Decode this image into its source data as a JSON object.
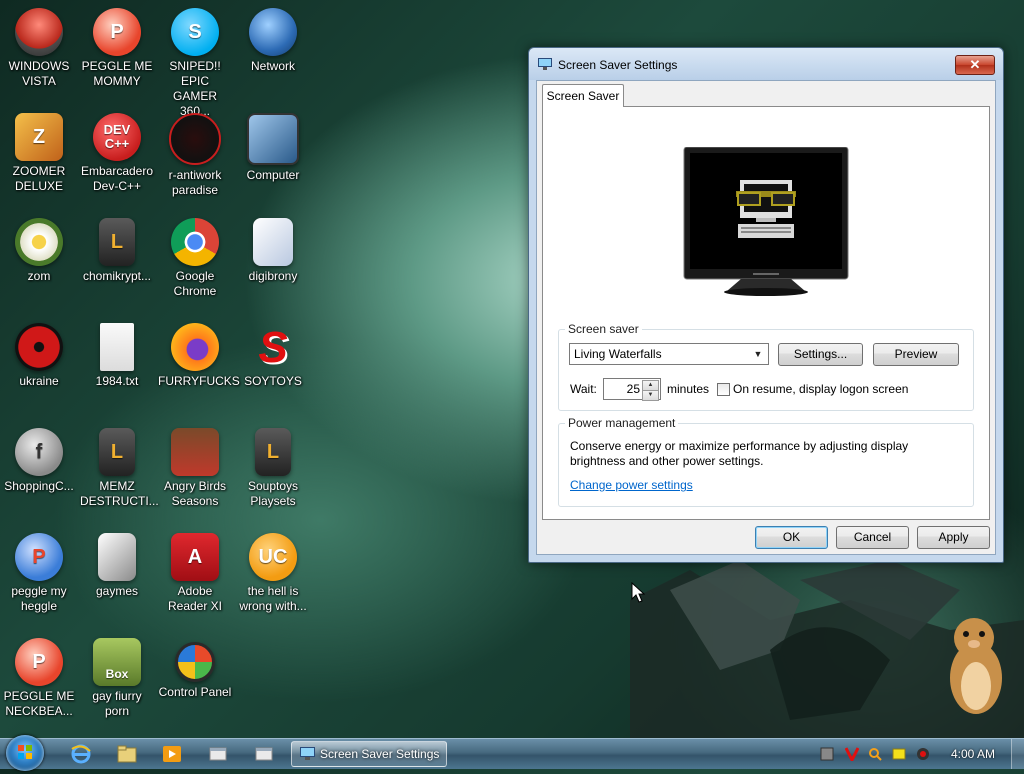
{
  "desktop": {
    "icons": [
      {
        "label": "WINDOWS VISTA",
        "icon": "vista-ball-icon",
        "color": "#c0392b"
      },
      {
        "label": "PEGGLE ME MOMMY",
        "icon": "peggle-p-icon",
        "color": "#e8452c"
      },
      {
        "label": "SNIPED!! EPIC GAMER 360...",
        "icon": "skype-icon",
        "color": "#00aff0"
      },
      {
        "label": "Network",
        "icon": "network-globe-icon",
        "color": "#2d6bb5"
      },
      {
        "label": "ZOOMER DELUXE",
        "icon": "zuma-icon",
        "color": "#d08a1a"
      },
      {
        "label": "Embarcadero Dev-C++",
        "icon": "devcpp-icon",
        "color": "#c81e1e"
      },
      {
        "label": "r-antiwork paradise",
        "icon": "antiwork-icon",
        "color": "#222222"
      },
      {
        "label": "Computer",
        "icon": "computer-icon",
        "color": "#3a6fa8"
      },
      {
        "label": "zom",
        "icon": "flower-icon",
        "color": "#e9e9d0"
      },
      {
        "label": "chomikrypt...",
        "icon": "shortcut-clock-icon",
        "color": "#3a3a3a"
      },
      {
        "label": "Google Chrome",
        "icon": "chrome-icon",
        "color": "#db4437"
      },
      {
        "label": "digibrony",
        "icon": "digibrony-icon",
        "color": "#e8eef8"
      },
      {
        "label": "ukraine",
        "icon": "radiation-icon",
        "color": "#d01818"
      },
      {
        "label": "1984.txt",
        "icon": "text-file-icon",
        "color": "#f2f2f2"
      },
      {
        "label": "FURRYFUCKS",
        "icon": "firefox-icon",
        "color": "#ff7b1a"
      },
      {
        "label": "SOYTOYS",
        "icon": "soytoys-s-icon",
        "color": "#e01010"
      },
      {
        "label": "ShoppingC...",
        "icon": "flash-icon",
        "color": "#8a8a8a"
      },
      {
        "label": "MEMZ DESTRUCTI...",
        "icon": "shortcut-clock-icon",
        "color": "#3a3a3a"
      },
      {
        "label": "Angry Birds Seasons",
        "icon": "angry-birds-icon",
        "color": "#c0392b"
      },
      {
        "label": "Souptoys Playsets",
        "icon": "shortcut-clock-icon",
        "color": "#3a3a3a"
      },
      {
        "label": "peggle my heggle",
        "icon": "peggle-p-icon",
        "color": "#3b7dd8"
      },
      {
        "label": "gaymes",
        "icon": "documents-icon",
        "color": "#6a6a6a"
      },
      {
        "label": "Adobe Reader XI",
        "icon": "adobe-reader-icon",
        "color": "#c8141e"
      },
      {
        "label": "the hell is wrong with...",
        "icon": "uc-browser-icon",
        "color": "#f39c12"
      },
      {
        "label": "PEGGLE ME NECKBEA...",
        "icon": "peggle-p-icon",
        "color": "#e8452c"
      },
      {
        "label": "gay fiurry porn",
        "icon": "box-hamster-icon",
        "color": "#7a9a3a"
      },
      {
        "label": "Control Panel",
        "icon": "control-panel-icon",
        "color": "#3a7a3a"
      }
    ]
  },
  "dialog": {
    "title": "Screen Saver Settings",
    "close_glyph": "✕",
    "tab_label": "Screen Saver",
    "screensaver_group": {
      "legend": "Screen saver",
      "selected": "Living Waterfalls",
      "settings_label": "Settings...",
      "preview_label": "Preview",
      "wait_label": "Wait:",
      "wait_value": "25",
      "minutes_label": "minutes",
      "resume_label": "On resume, display logon screen",
      "resume_checked": false
    },
    "power_group": {
      "legend": "Power management",
      "description": "Conserve energy or maximize performance by adjusting display brightness and other power settings.",
      "link": "Change power settings"
    },
    "ok_label": "OK",
    "cancel_label": "Cancel",
    "apply_label": "Apply"
  },
  "taskbar": {
    "task_label": "Screen Saver Settings",
    "clock": "4:00 AM",
    "quick_launch": [
      "ie-icon",
      "explorer-folder-icon",
      "media-player-icon",
      "window-icon",
      "window-icon"
    ],
    "tray": [
      "tray-app-icon",
      "tray-v-icon",
      "tray-search-icon",
      "tray-note-icon",
      "tray-record-icon"
    ]
  }
}
